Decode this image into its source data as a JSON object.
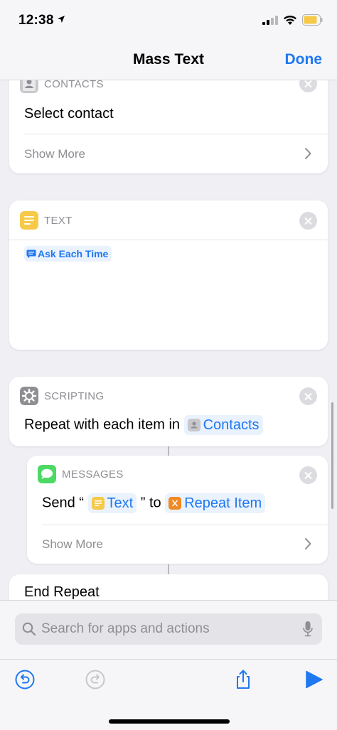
{
  "status": {
    "time": "12:38"
  },
  "nav": {
    "title": "Mass Text",
    "done_label": "Done"
  },
  "cards": {
    "contacts": {
      "category": "CONTACTS",
      "action": "Select contact",
      "show_more": "Show More"
    },
    "text": {
      "category": "TEXT",
      "token_label": "Ask Each Time"
    },
    "scripting": {
      "category": "SCRIPTING",
      "action_prefix": "Repeat with each item in",
      "token_label": "Contacts"
    },
    "messages": {
      "category": "MESSAGES",
      "send_prefix": "Send “",
      "text_token": "Text",
      "to_label": "” to",
      "repeat_token": "Repeat Item",
      "show_more": "Show More"
    },
    "end_repeat": {
      "label": "End Repeat"
    }
  },
  "search": {
    "placeholder": "Search for apps and actions"
  },
  "toolbar": {
    "items": [
      "undo-icon",
      "redo-icon",
      "share-icon",
      "play-icon"
    ]
  },
  "colors": {
    "accent": "#1f78f0",
    "background": "#efeff4",
    "card": "#ffffff",
    "text_yellow": "#f7c948",
    "messages_green": "#4cd964",
    "variable_orange": "#f08a24"
  }
}
